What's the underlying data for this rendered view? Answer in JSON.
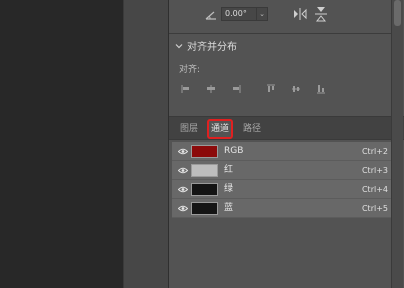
{
  "transform": {
    "angle_value": "0.00°",
    "icons": [
      "angle-icon",
      "chevron-down-icon",
      "flip-horizontal-icon",
      "flip-vertical-icon"
    ]
  },
  "align_section": {
    "title": "对齐并分布",
    "label": "对齐:",
    "icons": [
      "align-left-icon",
      "align-center-icon",
      "align-right-icon",
      "align-top-icon",
      "align-middle-icon",
      "align-bottom-icon"
    ]
  },
  "tabs": [
    {
      "label": "图层",
      "active": false
    },
    {
      "label": "通道",
      "active": true
    },
    {
      "label": "路径",
      "active": false
    }
  ],
  "channels": [
    {
      "name": "RGB",
      "shortcut": "Ctrl+2",
      "thumb_color": "#8b0a0a"
    },
    {
      "name": "红",
      "shortcut": "Ctrl+3",
      "thumb_color": "#bdbdbd"
    },
    {
      "name": "绿",
      "shortcut": "Ctrl+4",
      "thumb_color": "#141414"
    },
    {
      "name": "蓝",
      "shortcut": "Ctrl+5",
      "thumb_color": "#151515"
    }
  ],
  "colors": {
    "highlight": "#e02020"
  }
}
